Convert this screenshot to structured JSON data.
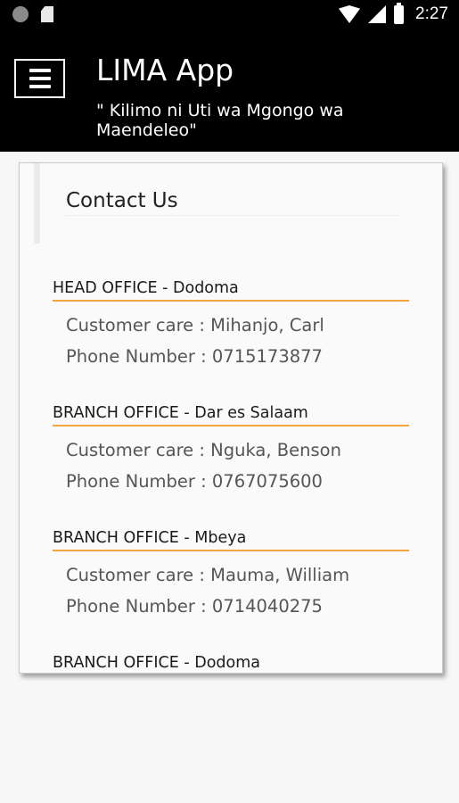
{
  "status_bar": {
    "time": "2:27",
    "icons": [
      "notification-dot-icon",
      "sd-card-icon",
      "wifi-icon",
      "signal-icon",
      "battery-icon"
    ]
  },
  "app_bar": {
    "title": "LIMA App",
    "subtitle": "\" Kilimo ni Uti wa Mgongo wa Maendeleo\"",
    "menu_icon": "hamburger-menu-icon"
  },
  "contact": {
    "title": "Contact Us",
    "offices": [
      {
        "heading": "HEAD OFFICE - Dodoma",
        "customer_care": "Customer care : Mihanjo, Carl",
        "phone": "Phone Number : 0715173877"
      },
      {
        "heading": "BRANCH OFFICE - Dar es Salaam",
        "customer_care": "Customer care : Nguka, Benson",
        "phone": "Phone Number : 0767075600"
      },
      {
        "heading": "BRANCH OFFICE - Mbeya",
        "customer_care": "Customer care : Mauma, William",
        "phone": "Phone Number : 0714040275"
      },
      {
        "heading": "BRANCH OFFICE - Dodoma"
      }
    ]
  },
  "colors": {
    "app_bar": "#000000",
    "accent_underline": "#f3a43a",
    "background": "#f7f7f7"
  }
}
